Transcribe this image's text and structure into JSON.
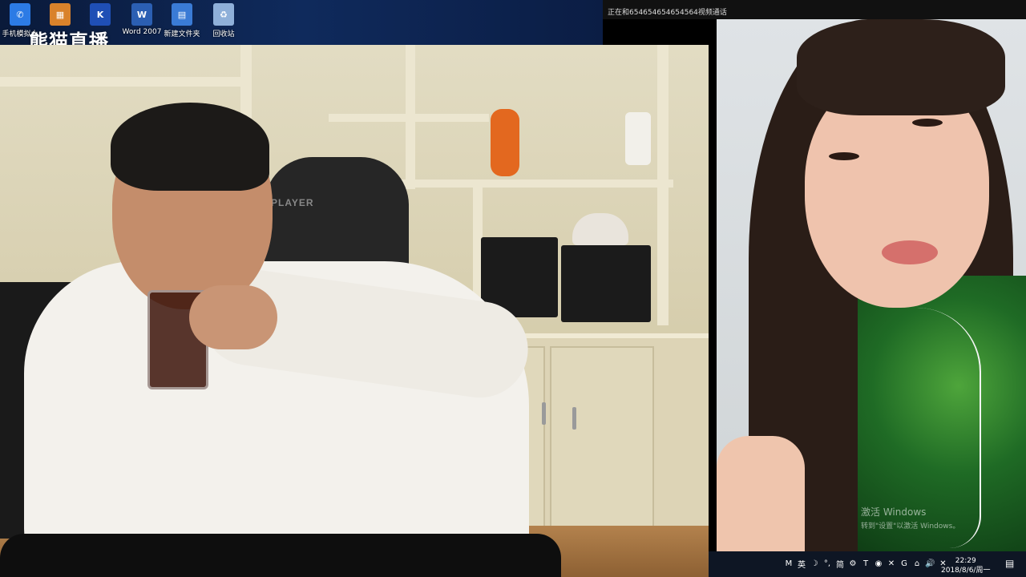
{
  "desktop": {
    "icons": [
      {
        "label": "手机模拟大",
        "glyph": "✆",
        "color": "#2c7be5"
      },
      {
        "label": "",
        "glyph": "▦",
        "color": "#d9822b"
      },
      {
        "label": "",
        "glyph": "K",
        "color": "#1f4fb5"
      },
      {
        "label": "Word 2007",
        "glyph": "W",
        "color": "#2b5fb3"
      },
      {
        "label": "新建文件夹",
        "glyph": "▤",
        "color": "#3a7bd5"
      },
      {
        "label": "回收站",
        "glyph": "♻",
        "color": "#8fb0d9"
      }
    ],
    "watermark": "熊猫直播"
  },
  "call": {
    "title": "正在和654654654654564视频通话"
  },
  "left_feed": {
    "chair_brand": "PLAYER"
  },
  "right_feed": {
    "activation_title": "激活 Windows",
    "activation_subtitle": "转到\"设置\"以激活 Windows。"
  },
  "taskbar": {
    "tray": [
      "M",
      "英",
      "☽",
      "°,",
      "简",
      "⚙",
      "T",
      "◉",
      "✕",
      "G",
      "⌂",
      "🔊",
      "✕"
    ],
    "time": "22:29",
    "date": "2018/8/6/周一",
    "notification_glyph": "▤"
  }
}
